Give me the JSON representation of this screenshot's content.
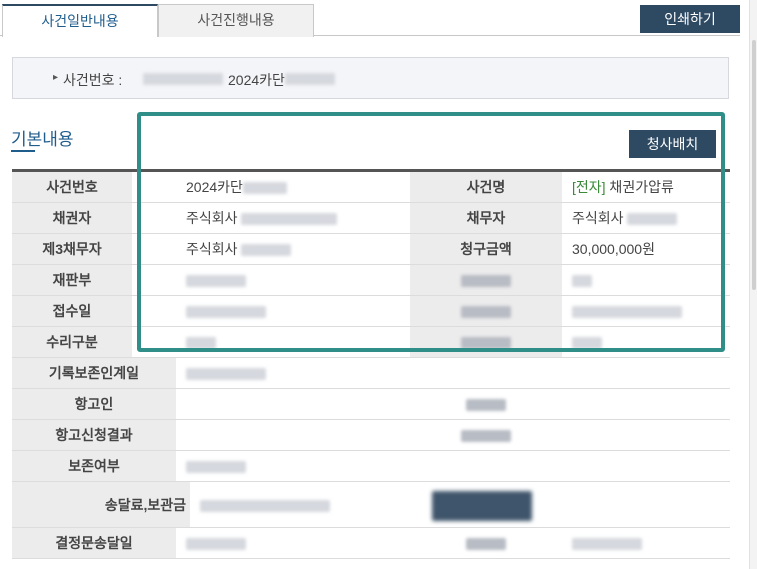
{
  "tabs": [
    {
      "label": "사건일반내용"
    },
    {
      "label": "사건진행내용"
    }
  ],
  "print_button": "인쇄하기",
  "case_box": {
    "label": "사건번호 :",
    "value": "2024카단"
  },
  "section_title": "기본내용",
  "assign_button": "청사배치",
  "rows": [
    {
      "h1": "사건번호",
      "v1": "2024카단",
      "h2": "사건명",
      "v2_tag": "[전자]",
      "v2": " 채권가압류"
    },
    {
      "h1": "채권자",
      "v1": "주식회사 ",
      "h2": "채무자",
      "v2": "주식회사 "
    },
    {
      "h1": "제3채무자",
      "v1": "주식회사 ",
      "h2": "청구금액",
      "v2": "30,000,000원"
    },
    {
      "h1": "재판부"
    },
    {
      "h1": "접수일"
    },
    {
      "h1": "수리구분"
    },
    {
      "h1": "기록보존인계일"
    },
    {
      "h1": "항고인"
    },
    {
      "h1": "항고신청결과"
    },
    {
      "h1": "보존여부"
    },
    {
      "h1": "송달료,보관금"
    },
    {
      "h1": "결정문송달일"
    }
  ]
}
